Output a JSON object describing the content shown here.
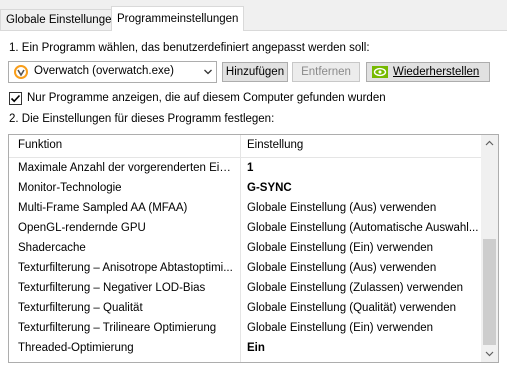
{
  "tabs": [
    {
      "label": "Globale Einstellungen",
      "active": false
    },
    {
      "label": "Programmeinstellungen",
      "active": true
    }
  ],
  "step1_label": "1. Ein Programm wählen, das benutzerdefiniert angepasst werden soll:",
  "program_select": {
    "value": "Overwatch (overwatch.exe)",
    "icon": "overwatch-icon"
  },
  "buttons": {
    "add": "Hinzufügen",
    "remove": "Entfernen",
    "restore": "Wiederherstellen"
  },
  "checkbox": {
    "label": "Nur Programme anzeigen, die auf diesem Computer gefunden wurden",
    "checked": true
  },
  "step2_label": "2. Die Einstellungen für dieses Programm festlegen:",
  "table": {
    "columns": [
      "Funktion",
      "Einstellung"
    ],
    "rows": [
      {
        "feature": "Maximale Anzahl der vorgerenderten Einz...",
        "setting": "1",
        "bold": true
      },
      {
        "feature": "Monitor-Technologie",
        "setting": "G-SYNC",
        "bold": true
      },
      {
        "feature": "Multi-Frame Sampled AA (MFAA)",
        "setting": "Globale Einstellung (Aus) verwenden",
        "bold": false
      },
      {
        "feature": "OpenGL-rendernde GPU",
        "setting": "Globale Einstellung (Automatische Auswahl...",
        "bold": false
      },
      {
        "feature": "Shadercache",
        "setting": "Globale Einstellung (Ein) verwenden",
        "bold": false
      },
      {
        "feature": "Texturfilterung – Anisotrope Abtastoptimi...",
        "setting": "Globale Einstellung (Aus) verwenden",
        "bold": false
      },
      {
        "feature": "Texturfilterung – Negativer LOD-Bias",
        "setting": "Globale Einstellung (Zulassen) verwenden",
        "bold": false
      },
      {
        "feature": "Texturfilterung – Qualität",
        "setting": "Globale Einstellung (Qualität) verwenden",
        "bold": false
      },
      {
        "feature": "Texturfilterung – Trilineare Optimierung",
        "setting": "Globale Einstellung (Ein) verwenden",
        "bold": false
      },
      {
        "feature": "Threaded-Optimierung",
        "setting": "Ein",
        "bold": true
      }
    ]
  },
  "colors": {
    "nvidia_green": "#76b900",
    "overwatch_orange": "#f99e1a"
  }
}
